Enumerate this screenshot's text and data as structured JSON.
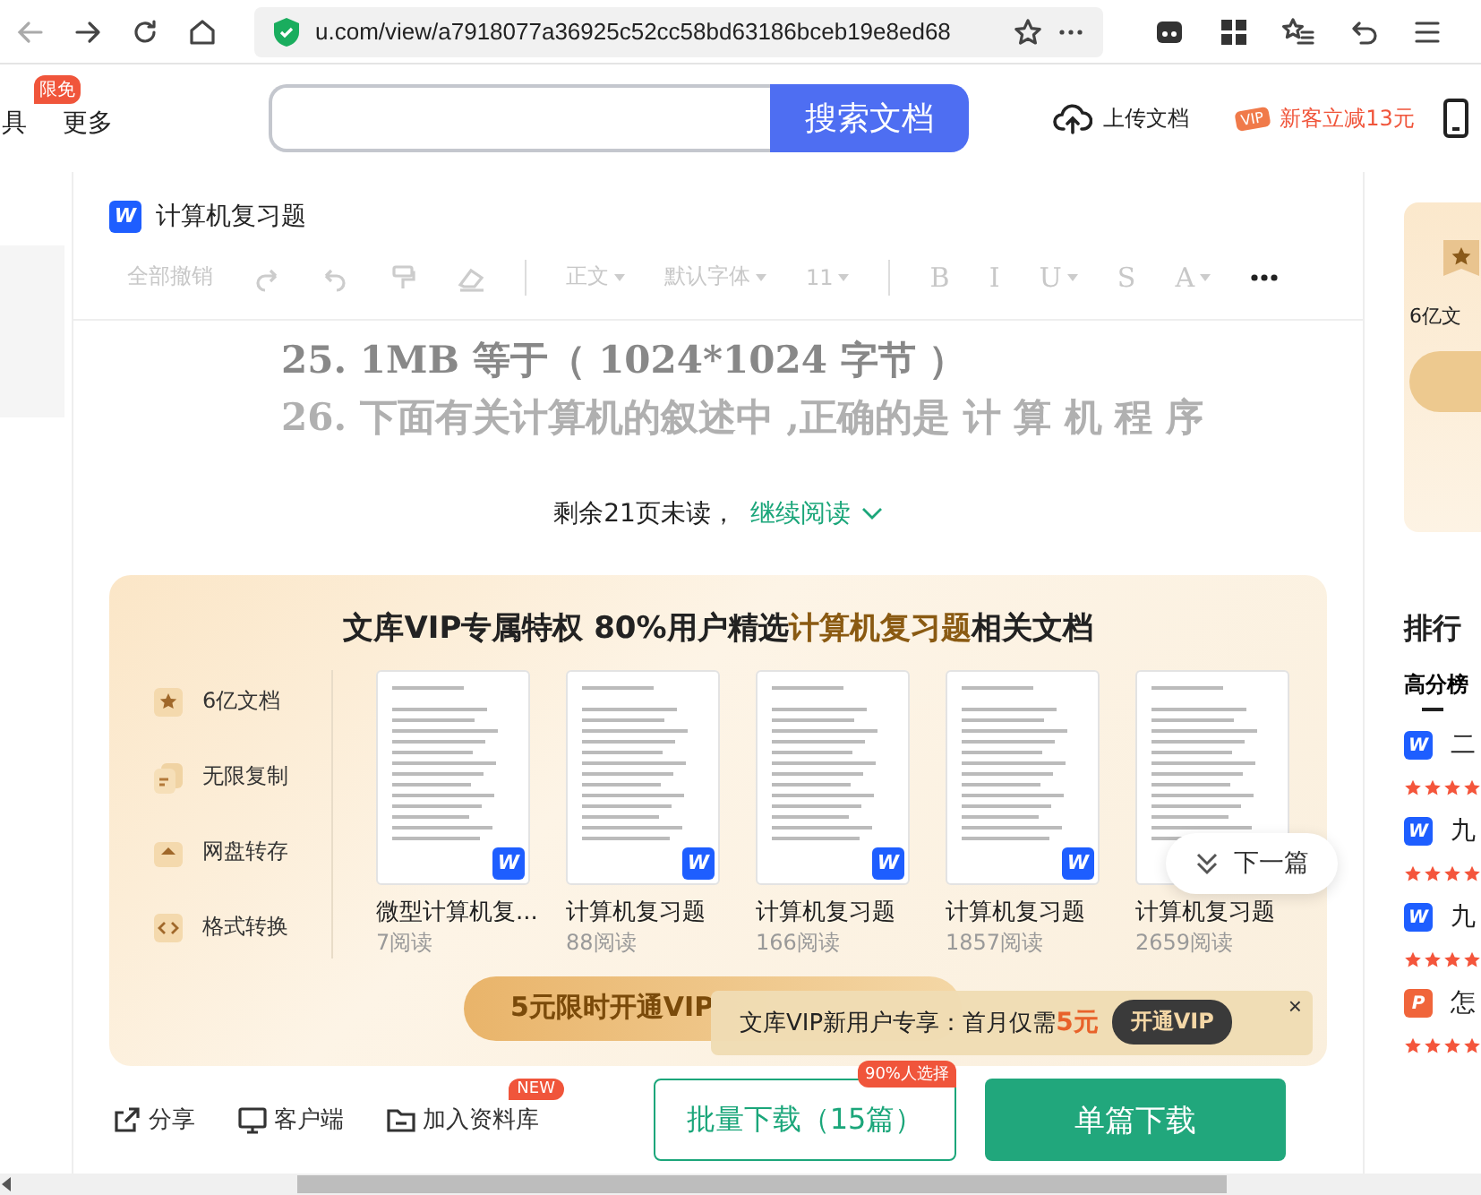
{
  "browser": {
    "url": "u.com/view/a7918077a36925c52cc58bd63186bceb19e8ed68"
  },
  "header": {
    "nav": [
      {
        "label": "具",
        "badge": "限免"
      },
      {
        "label": "更多"
      }
    ],
    "search_button": "搜索文档",
    "upload": "上传文档",
    "promo_tag": "VIP",
    "promo": "新客立减13元"
  },
  "document": {
    "badge": "W",
    "title": "计算机复习题",
    "toolbar": [
      {
        "kind": "text",
        "label": "全部撤销"
      },
      {
        "kind": "icon"
      },
      {
        "kind": "icon"
      },
      {
        "kind": "icon"
      },
      {
        "kind": "icon"
      },
      {
        "kind": "dropdown",
        "label": "正文"
      },
      {
        "kind": "dropdown",
        "label": "默认字体"
      },
      {
        "kind": "dropdown",
        "label": "11"
      },
      {
        "kind": "glyph",
        "label": "B"
      },
      {
        "kind": "glyph",
        "label": "I"
      },
      {
        "kind": "glyph",
        "label": "U",
        "caret": true
      },
      {
        "kind": "glyph",
        "label": "S"
      },
      {
        "kind": "glyph",
        "label": "A",
        "caret": true
      },
      {
        "kind": "icon"
      }
    ],
    "lines": [
      "25. 1MB  等于（  1024*1024  字节  ）",
      "26. 下面有关计算机的叙述中 ,正确的是  计 算 机 程 序"
    ],
    "remaining": "剩余21页未读，",
    "continue": "继续阅读"
  },
  "vip_panel": {
    "title": "文库VIP专属特权 80%用户精选**计算机复习题**相关文档",
    "features": [
      "6亿文档",
      "无限复制",
      "网盘转存",
      "格式转换"
    ],
    "docs": [
      {
        "title": "微型计算机复...",
        "reads": "7阅读",
        "badge": "W"
      },
      {
        "title": "计算机复习题",
        "reads": "88阅读",
        "badge": "W"
      },
      {
        "title": "计算机复习题",
        "reads": "166阅读",
        "badge": "W"
      },
      {
        "title": "计算机复习题",
        "reads": "1857阅读",
        "badge": "W"
      },
      {
        "title": "计算机复习题",
        "reads": "2659阅读"
      }
    ],
    "cta": "5元限时开通VIP",
    "next": "下一篇",
    "popup": {
      "text": "文库VIP新用户专享：首月仅需",
      "price": "5元",
      "button": "开通VIP",
      "close": "×"
    }
  },
  "bottom_bar": {
    "actions": [
      {
        "label": "分享"
      },
      {
        "label": "客户端"
      },
      {
        "label": "加入资料库",
        "badge": "NEW"
      }
    ],
    "batch": "批量下载（15篇）",
    "batch_badge": "90%人选择",
    "single": "单篇下载"
  },
  "right_rail": {
    "card_text": "6亿文",
    "ranking_title": "排行",
    "tab": "高分榜",
    "items": [
      {
        "kind": "word",
        "badge": "W",
        "title": "二",
        "stars": 4
      },
      {
        "kind": "word",
        "badge": "W",
        "title": "九",
        "stars": 4
      },
      {
        "kind": "word",
        "badge": "W",
        "title": "九",
        "stars": 4
      },
      {
        "kind": "ppt",
        "badge": "P",
        "title": "怎",
        "stars": 4
      }
    ]
  }
}
